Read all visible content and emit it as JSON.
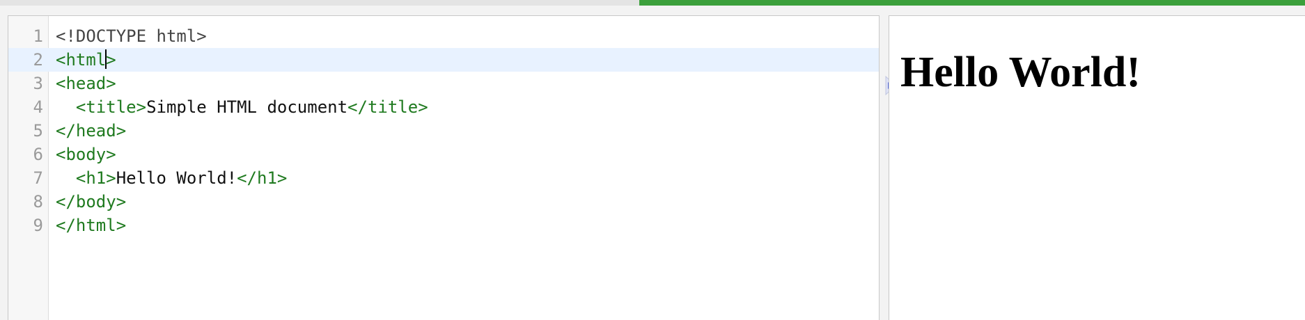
{
  "progress": {
    "fraction": 0.51,
    "color": "#3ca03c"
  },
  "editor": {
    "active_line": 2,
    "lines": [
      {
        "number": "1",
        "tokens": [
          {
            "type": "doctype",
            "text": "<!DOCTYPE html>"
          }
        ]
      },
      {
        "number": "2",
        "tokens": [
          {
            "type": "tag",
            "text": "<html"
          },
          {
            "type": "caret"
          },
          {
            "type": "tag",
            "text": ">"
          }
        ]
      },
      {
        "number": "3",
        "tokens": [
          {
            "type": "tag",
            "text": "<head>"
          }
        ]
      },
      {
        "number": "4",
        "tokens": [
          {
            "type": "text",
            "text": "  "
          },
          {
            "type": "tag",
            "text": "<title>"
          },
          {
            "type": "text",
            "text": "Simple HTML document"
          },
          {
            "type": "tag",
            "text": "</title>"
          }
        ]
      },
      {
        "number": "5",
        "tokens": [
          {
            "type": "tag",
            "text": "</head>"
          }
        ]
      },
      {
        "number": "6",
        "tokens": [
          {
            "type": "tag",
            "text": "<body>"
          }
        ]
      },
      {
        "number": "7",
        "tokens": [
          {
            "type": "text",
            "text": "  "
          },
          {
            "type": "tag",
            "text": "<h1>"
          },
          {
            "type": "text",
            "text": "Hello World!"
          },
          {
            "type": "tag",
            "text": "</h1>"
          }
        ]
      },
      {
        "number": "8",
        "tokens": [
          {
            "type": "tag",
            "text": "</body>"
          }
        ]
      },
      {
        "number": "9",
        "tokens": [
          {
            "type": "tag",
            "text": "</html>"
          }
        ]
      }
    ],
    "colors": {
      "tag": "#1f7a1f",
      "doctype": "#444444",
      "text": "#111111",
      "active_line_bg": "#e8f2ff"
    }
  },
  "splitter": {
    "icon": "expand-arrow-icon",
    "color": "#5b6fe0"
  },
  "preview": {
    "heading": "Hello World!"
  }
}
